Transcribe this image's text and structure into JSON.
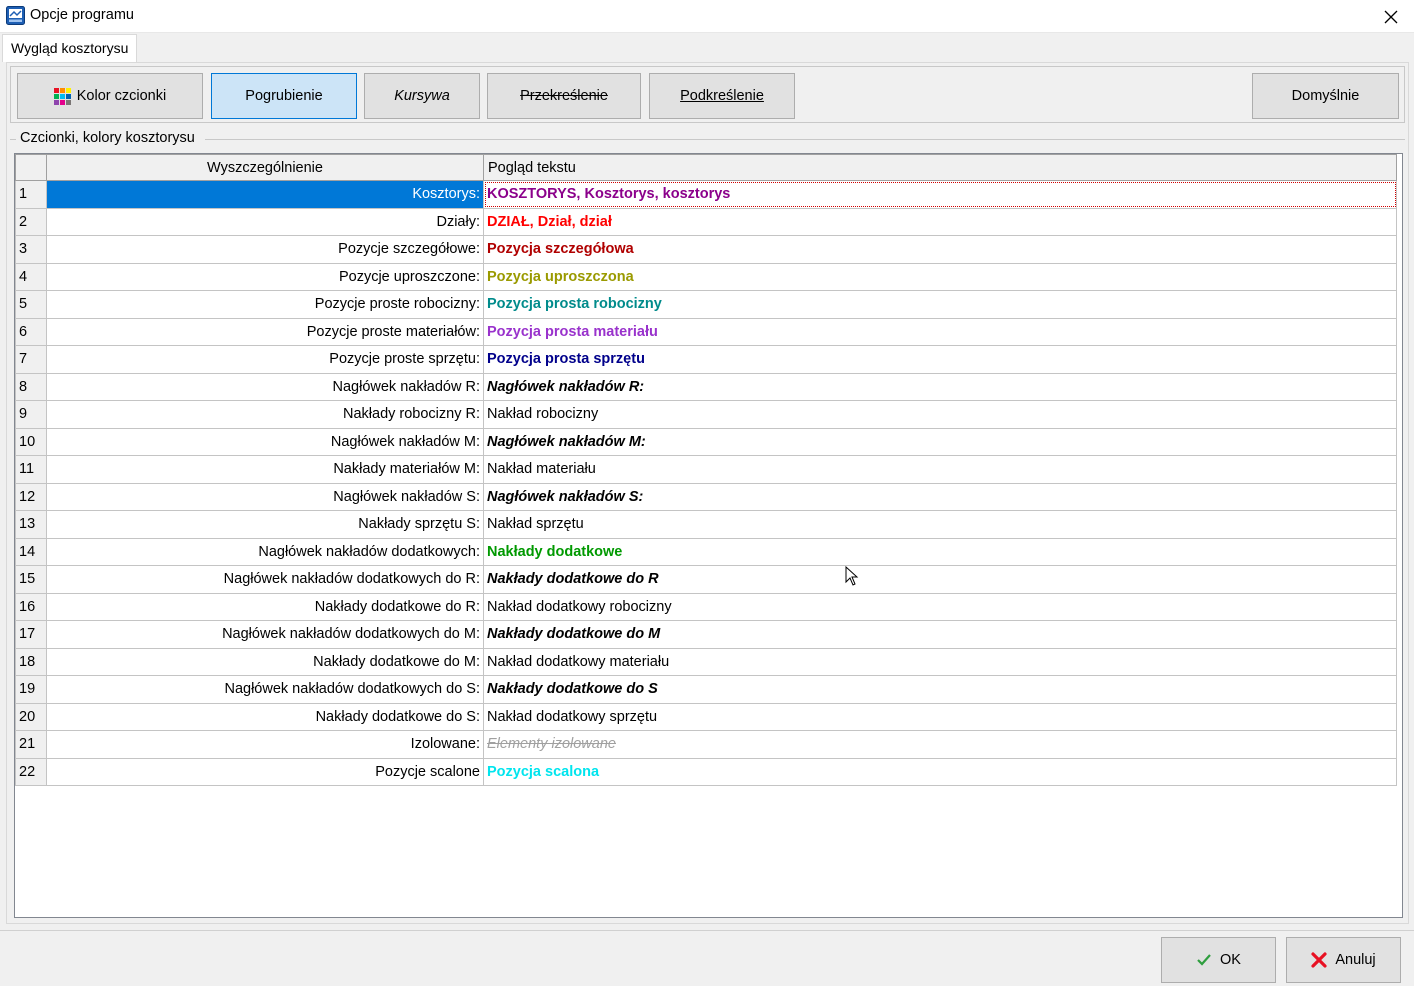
{
  "window": {
    "title": "Opcje programu",
    "app_icon": "app-icon",
    "close_icon": "close-icon"
  },
  "tabs": [
    {
      "label": "Wygląd kosztorysu",
      "active": true
    }
  ],
  "toolbar": {
    "font_color_label": "Kolor czcionki",
    "font_color_icon": "palette-icon",
    "bold_label": "Pogrubienie",
    "italic_label": "Kursywa",
    "strike_label": "Przekreślenie",
    "underline_label": "Podkreślenie",
    "default_label": "Domyślnie"
  },
  "group": {
    "label": "Czcionki, kolory kosztorysu"
  },
  "grid": {
    "columns": [
      "",
      "Wyszczególnienie",
      "Pogląd tekstu"
    ],
    "selected_row": 1,
    "rows": [
      {
        "n": "1",
        "label": "Kosztorys:",
        "preview": "KOSZTORYS, Kosztorys, kosztorys",
        "color": "#8b008b",
        "bold": true,
        "italic": false,
        "strike": false
      },
      {
        "n": "2",
        "label": "Działy:",
        "preview": "DZIAŁ, Dział, dział",
        "color": "#ff0000",
        "bold": true,
        "italic": false,
        "strike": false
      },
      {
        "n": "3",
        "label": "Pozycje szczegółowe:",
        "preview": "Pozycja szczegółowa",
        "color": "#b00000",
        "bold": true,
        "italic": false,
        "strike": false
      },
      {
        "n": "4",
        "label": "Pozycje uproszczone:",
        "preview": "Pozycja uproszczona",
        "color": "#9a9a00",
        "bold": true,
        "italic": false,
        "strike": false
      },
      {
        "n": "5",
        "label": "Pozycje proste robocizny:",
        "preview": "Pozycja prosta robocizny",
        "color": "#008b8b",
        "bold": true,
        "italic": false,
        "strike": false
      },
      {
        "n": "6",
        "label": "Pozycje proste materiałów:",
        "preview": "Pozycja prosta materiału",
        "color": "#9932cc",
        "bold": true,
        "italic": false,
        "strike": false
      },
      {
        "n": "7",
        "label": "Pozycje proste sprzętu:",
        "preview": "Pozycja prosta sprzętu",
        "color": "#00008b",
        "bold": true,
        "italic": false,
        "strike": false
      },
      {
        "n": "8",
        "label": "Nagłówek nakładów R:",
        "preview": "Nagłówek nakładów R:",
        "color": "#000000",
        "bold": true,
        "italic": true,
        "strike": false
      },
      {
        "n": "9",
        "label": "Nakłady robocizny R:",
        "preview": "Nakład robocizny",
        "color": "#000000",
        "bold": false,
        "italic": false,
        "strike": false
      },
      {
        "n": "10",
        "label": "Nagłówek nakładów M:",
        "preview": "Nagłówek nakładów M:",
        "color": "#000000",
        "bold": true,
        "italic": true,
        "strike": false
      },
      {
        "n": "11",
        "label": "Nakłady materiałów M:",
        "preview": "Nakład materiału",
        "color": "#000000",
        "bold": false,
        "italic": false,
        "strike": false
      },
      {
        "n": "12",
        "label": "Nagłówek nakładów S:",
        "preview": "Nagłówek nakładów S:",
        "color": "#000000",
        "bold": true,
        "italic": true,
        "strike": false
      },
      {
        "n": "13",
        "label": "Nakłady sprzętu S:",
        "preview": "Nakład sprzętu",
        "color": "#000000",
        "bold": false,
        "italic": false,
        "strike": false
      },
      {
        "n": "14",
        "label": "Nagłówek nakładów dodatkowych:",
        "preview": "Nakłady dodatkowe",
        "color": "#009900",
        "bold": true,
        "italic": false,
        "strike": false
      },
      {
        "n": "15",
        "label": "Nagłówek nakładów dodatkowych do R:",
        "preview": "Nakłady dodatkowe do R",
        "color": "#000000",
        "bold": true,
        "italic": true,
        "strike": false
      },
      {
        "n": "16",
        "label": "Nakłady dodatkowe do R:",
        "preview": "Nakład dodatkowy robocizny",
        "color": "#000000",
        "bold": false,
        "italic": false,
        "strike": false
      },
      {
        "n": "17",
        "label": "Nagłówek nakładów dodatkowych do M:",
        "preview": "Nakłady dodatkowe do M",
        "color": "#000000",
        "bold": true,
        "italic": true,
        "strike": false
      },
      {
        "n": "18",
        "label": "Nakłady dodatkowe do M:",
        "preview": "Nakład dodatkowy materiału",
        "color": "#000000",
        "bold": false,
        "italic": false,
        "strike": false
      },
      {
        "n": "19",
        "label": "Nagłówek nakładów dodatkowych do S:",
        "preview": "Nakłady dodatkowe do S",
        "color": "#000000",
        "bold": true,
        "italic": true,
        "strike": false
      },
      {
        "n": "20",
        "label": "Nakłady dodatkowe do S:",
        "preview": "Nakład dodatkowy sprzętu",
        "color": "#000000",
        "bold": false,
        "italic": false,
        "strike": false
      },
      {
        "n": "21",
        "label": "Izolowane:",
        "preview": "Elementy izolowane",
        "color": "#a0a0a0",
        "bold": false,
        "italic": true,
        "strike": true
      },
      {
        "n": "22",
        "label": "Pozycje scalone",
        "preview": "Pozycja scalona",
        "color": "#00e5ee",
        "bold": true,
        "italic": false,
        "strike": false
      }
    ]
  },
  "dialog_buttons": {
    "ok_label": "OK",
    "ok_icon": "checkmark-icon",
    "cancel_label": "Anuluj",
    "cancel_icon": "red-x-icon"
  },
  "colors": {
    "selection": "#0078d7",
    "active_button": "#cce4f7"
  }
}
